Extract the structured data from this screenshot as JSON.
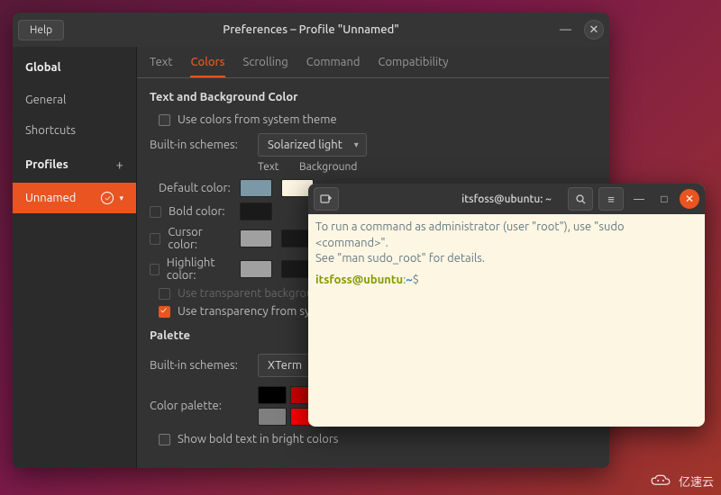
{
  "prefs": {
    "titlebar": {
      "help": "Help",
      "title": "Preferences – Profile \"Unnamed\""
    },
    "sidebar": {
      "global_header": "Global",
      "items": [
        "General",
        "Shortcuts"
      ],
      "profiles_header": "Profiles",
      "active_profile": "Unnamed"
    },
    "tabs": [
      "Text",
      "Colors",
      "Scrolling",
      "Command",
      "Compatibility"
    ],
    "active_tab": "Colors",
    "colors": {
      "section_title": "Text and Background Color",
      "use_system_theme": "Use colors from system theme",
      "builtin_label": "Built-in schemes:",
      "builtin_value": "Solarized light",
      "col_text": "Text",
      "col_bg": "Background",
      "default_label": "Default color:",
      "default_text_color": "#7b98a6",
      "default_bg_color": "#fdf6e3",
      "bold_label": "Bold color:",
      "bold_text_color": "#1a1a1a",
      "cursor_label": "Cursor color:",
      "cursor_text_color": "#a0a0a0",
      "cursor_bg_color": "#1a1a1a",
      "highlight_label": "Highlight color:",
      "highlight_text_color": "#a0a0a0",
      "highlight_bg_color": "#1a1a1a",
      "use_transparent_bg": "Use transparent background",
      "use_transparency_system": "Use transparency from system theme",
      "palette_title": "Palette",
      "palette_scheme_label": "Built-in schemes:",
      "palette_scheme_value": "XTerm",
      "palette_label": "Color palette:",
      "palette_row1": [
        "#000000",
        "#cd0000"
      ],
      "palette_row2": [
        "#7f7f7f",
        "#ff0000"
      ],
      "show_bold_bright": "Show bold text in bright colors"
    }
  },
  "terminal": {
    "title": "itsfoss@ubuntu: ~",
    "line1": "To run a command as administrator (user \"root\"), use \"sudo <command>\".",
    "line2": "See \"man sudo_root\" for details.",
    "prompt_user": "itsfoss@ubuntu",
    "prompt_sep": ":",
    "prompt_path": "~",
    "prompt_end": "$"
  },
  "watermark": "亿速云"
}
